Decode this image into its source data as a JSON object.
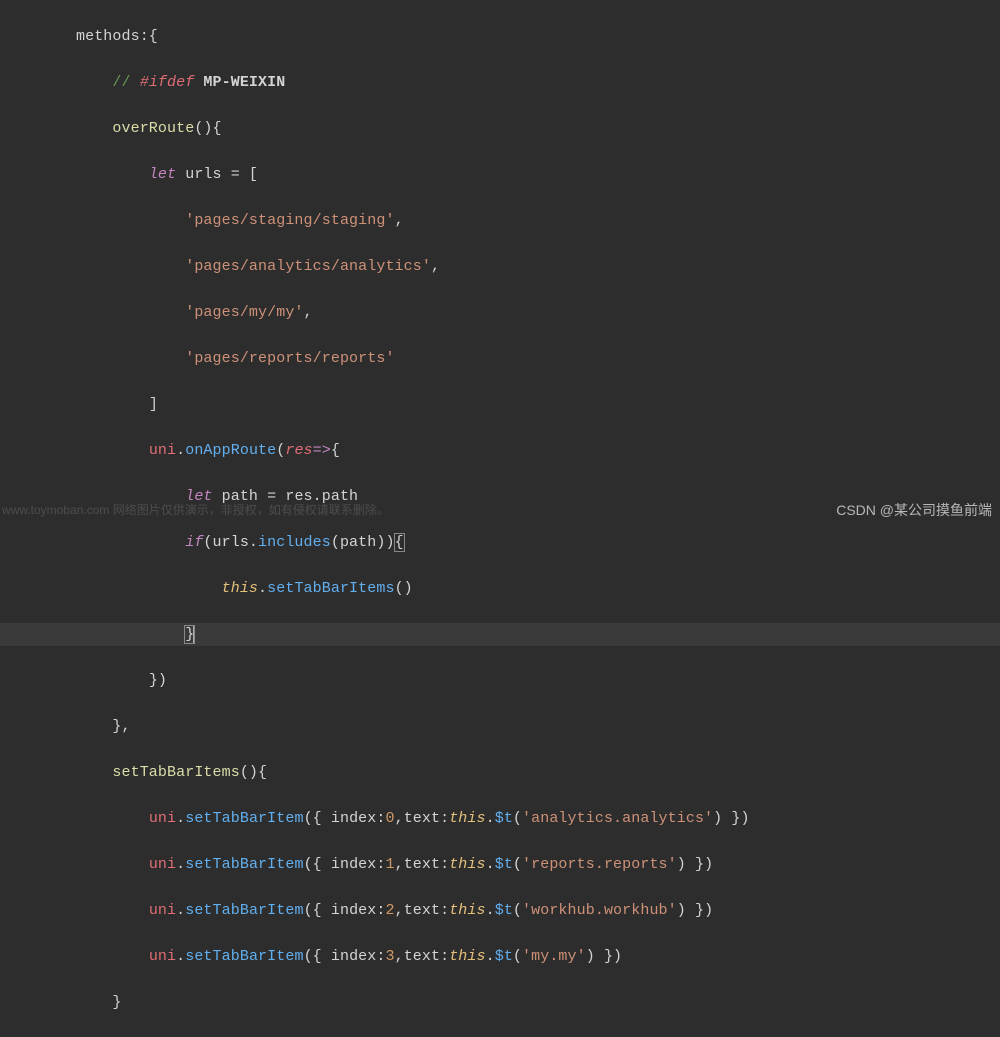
{
  "code": {
    "l1": "methods:{",
    "l2_comment": "// ",
    "l2_ifdef": "#ifdef",
    "l2_def": " MP-WEIXIN",
    "l3_fn": "overRoute",
    "l3_end": "(){",
    "l4_let": "let",
    "l4_rest": " urls = [",
    "l5": "'pages/staging/staging'",
    "l5_c": ",",
    "l6": "'pages/analytics/analytics'",
    "l6_c": ",",
    "l7": "'pages/my/my'",
    "l7_c": ",",
    "l8": "'pages/reports/reports'",
    "l9": "]",
    "l10_obj": "uni",
    "l10_dot": ".",
    "l10_fn": "onAppRoute",
    "l10_op": "(",
    "l10_param": "res",
    "l10_arrow": "=>",
    "l10_ob": "{",
    "l11_let": "let",
    "l11_mid": " path = res.path",
    "l12_if": "if",
    "l12_op": "(urls.",
    "l12_fn": "includes",
    "l12_arg": "(path))",
    "l12_ob": "{",
    "l13_this": "this",
    "l13_dot": ".",
    "l13_fn": "setTabBarItems",
    "l13_end": "()",
    "l14_cb": "}",
    "l15": "})",
    "l16": "},",
    "l17_fn": "setTabBarItems",
    "l17_end": "(){",
    "l18_obj": "uni",
    "l18_dot": ".",
    "l18_fn": "setTabBarItem",
    "l18_op": "({ index:",
    "l18_n": "0",
    "l18_mid": ",text:",
    "l18_this": "this",
    "l18_dot2": ".",
    "l18_t": "$t",
    "l18_op2": "(",
    "l18_s": "'analytics.analytics'",
    "l18_end": ") })",
    "l19_obj": "uni",
    "l19_fn": "setTabBarItem",
    "l19_op": "({ index:",
    "l19_n": "1",
    "l19_mid": ",text:",
    "l19_this": "this",
    "l19_t": "$t",
    "l19_s": "'reports.reports'",
    "l19_end": ") })",
    "l20_obj": "uni",
    "l20_fn": "setTabBarItem",
    "l20_op": "({ index:",
    "l20_n": "2",
    "l20_mid": ",text:",
    "l20_this": "this",
    "l20_t": "$t",
    "l20_s": "'workhub.workhub'",
    "l20_end": ") })",
    "l21_obj": "uni",
    "l21_fn": "setTabBarItem",
    "l21_op": "({ index:",
    "l21_n": "3",
    "l21_mid": ",text:",
    "l21_this": "this",
    "l21_t": "$t",
    "l21_s": "'my.my'",
    "l21_end": ") })",
    "l22": "}"
  },
  "watermark_left": "www.toymoban.com 网络图片仅供演示，非授权，如有侵权请联系删除。",
  "watermark_right": "CSDN @某公司摸鱼前端"
}
